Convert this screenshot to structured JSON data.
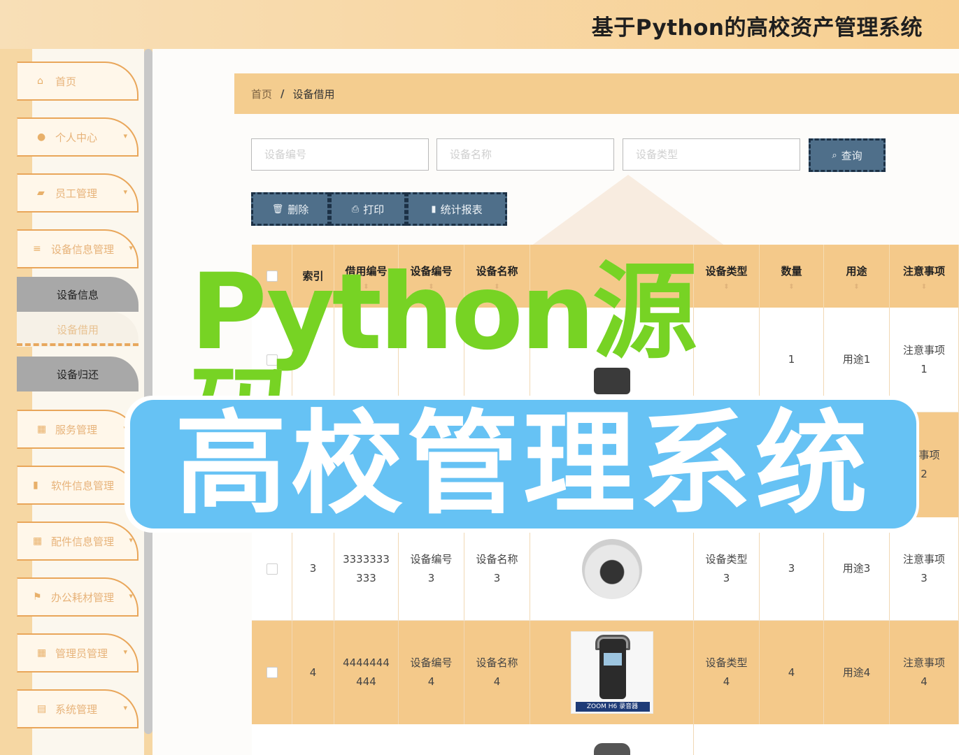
{
  "header": {
    "title": "基于Python的高校资产管理系统"
  },
  "sidebar": {
    "items": [
      {
        "label": "首页",
        "icon": "home-icon",
        "glyph": "⌂",
        "chevron": false
      },
      {
        "label": "个人中心",
        "icon": "user-icon",
        "glyph": "●",
        "chevron": true
      },
      {
        "label": "员工管理",
        "icon": "thumb-icon",
        "glyph": "▰",
        "chevron": true
      },
      {
        "label": "设备信息管理",
        "icon": "sliders-icon",
        "glyph": "≡",
        "chevron": true
      },
      {
        "label": "服务管理",
        "icon": "grid-icon",
        "glyph": "▦",
        "chevron": true
      },
      {
        "label": "软件信息管理",
        "icon": "bar-chart-icon",
        "glyph": "▮",
        "chevron": true
      },
      {
        "label": "配件信息管理",
        "icon": "grid-icon",
        "glyph": "▦",
        "chevron": true
      },
      {
        "label": "办公耗材管理",
        "icon": "flag-icon",
        "glyph": "⚑",
        "chevron": true
      },
      {
        "label": "管理员管理",
        "icon": "grid-icon",
        "glyph": "▦",
        "chevron": true
      },
      {
        "label": "系统管理",
        "icon": "clipboard-icon",
        "glyph": "▤",
        "chevron": true
      }
    ],
    "sub_items": [
      {
        "label": "设备信息"
      },
      {
        "label": "设备借用"
      },
      {
        "label": "设备归还"
      }
    ]
  },
  "breadcrumb": {
    "home": "首页",
    "separator": "/",
    "current": "设备借用"
  },
  "search": {
    "device_no_placeholder": "设备编号",
    "device_name_placeholder": "设备名称",
    "device_type_placeholder": "设备类型",
    "query_label": "查询",
    "query_glyph": "⌕"
  },
  "actions": {
    "delete_label": "删除",
    "delete_glyph": "🗑",
    "print_label": "打印",
    "print_glyph": "⎙",
    "report_label": "统计报表",
    "report_glyph": "▮"
  },
  "table": {
    "headers": [
      "",
      "索引",
      "借用编号",
      "设备编号",
      "设备名称",
      "",
      "设备类型",
      "数量",
      "用途",
      "注意事项"
    ],
    "sort_glyph": "⬍",
    "rows": [
      {
        "index": "",
        "borrow_no": "",
        "device_no": "",
        "device_name": "",
        "device_type": "",
        "qty": "1",
        "usage": "用途1",
        "note": "注意事项\n1"
      },
      {
        "index": "",
        "borrow_no": "",
        "device_no": "",
        "device_name": "",
        "device_type": "",
        "qty": "",
        "usage": "",
        "note": "意事项\n2"
      },
      {
        "index": "3",
        "borrow_no": "3333333\n333",
        "device_no": "设备编号\n3",
        "device_name": "设备名称\n3",
        "device_type": "设备类型\n3",
        "qty": "3",
        "usage": "用途3",
        "note": "注意事项\n3"
      },
      {
        "index": "4",
        "borrow_no": "4444444\n444",
        "device_no": "设备编号\n4",
        "device_name": "设备名称\n4",
        "device_type": "设备类型\n4",
        "qty": "4",
        "usage": "用途4",
        "note": "注意事项\n4"
      }
    ],
    "image_label": "ZOOM H6 录音器"
  },
  "overlay": {
    "line1": "Python源码",
    "line2": "高校管理系统"
  }
}
